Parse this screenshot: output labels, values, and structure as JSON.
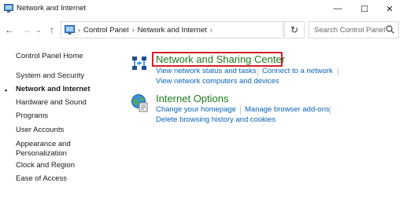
{
  "window": {
    "title": "Network and Internet",
    "min_glyph": "—",
    "max_glyph": "☐",
    "close_glyph": "✕"
  },
  "nav": {
    "back_glyph": "←",
    "forward_glyph": "→",
    "recent_glyph": "⌄",
    "up_glyph": "↑",
    "refresh_glyph": "↻"
  },
  "address": {
    "separator": "›",
    "crumbs": [
      "Control Panel",
      "Network and Internet"
    ],
    "dropdown_glyph": "⌄"
  },
  "search": {
    "placeholder": "Search Control Panel",
    "icon": "search-icon"
  },
  "sidebar": {
    "items": [
      {
        "label": "Control Panel Home",
        "active": false
      },
      {
        "label": "System and Security",
        "active": false
      },
      {
        "label": "Network and Internet",
        "active": true
      },
      {
        "label": "Hardware and Sound",
        "active": false
      },
      {
        "label": "Programs",
        "active": false
      },
      {
        "label": "User Accounts",
        "active": false
      },
      {
        "label": "Appearance and",
        "active": false
      },
      {
        "label": "Personalization",
        "active": false
      },
      {
        "label": "Clock and Region",
        "active": false
      },
      {
        "label": "Ease of Access",
        "active": false
      }
    ],
    "bullet": "•"
  },
  "sections": [
    {
      "title": "Network and Sharing Center",
      "icon": "network-sharing-icon",
      "highlighted": true,
      "links": [
        "View network status and tasks",
        "Connect to a network",
        "View network computers and devices"
      ]
    },
    {
      "title": "Internet Options",
      "icon": "internet-options-icon",
      "highlighted": false,
      "links": [
        "Change your homepage",
        "Manage browser add-ons",
        "Delete browsing history and cookies"
      ]
    }
  ],
  "colors": {
    "section_title": "#1e7b1e",
    "link": "#0b63b7",
    "highlight": "#d4202b"
  }
}
